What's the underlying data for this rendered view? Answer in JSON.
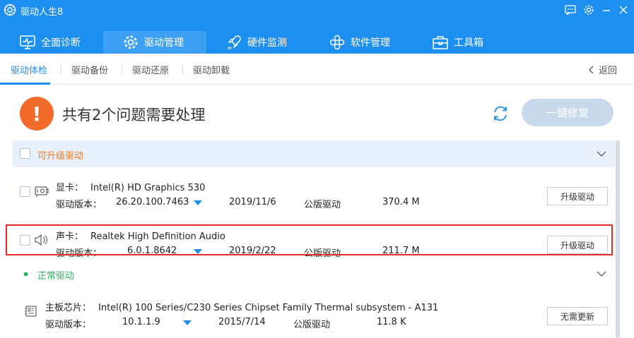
{
  "app": {
    "title": "驱动人生8"
  },
  "nav": {
    "tabs": [
      {
        "label": "全面诊断",
        "icon": "monitor-pulse-icon"
      },
      {
        "label": "驱动管理",
        "icon": "gear-icon",
        "active": true
      },
      {
        "label": "硬件监测",
        "icon": "rocket-icon"
      },
      {
        "label": "软件管理",
        "icon": "apps-icon"
      },
      {
        "label": "工具箱",
        "icon": "toolbox-icon"
      }
    ]
  },
  "subnav": {
    "items": [
      "驱动体检",
      "驱动备份",
      "驱动还原",
      "驱动卸载"
    ],
    "back_label": "返回"
  },
  "summary": {
    "title": "共有2个问题需要处理",
    "fix_all_label": "一键修复"
  },
  "sections": {
    "upgradable": {
      "label": "可升级驱动"
    },
    "normal": {
      "label": "正常驱动"
    }
  },
  "drivers": [
    {
      "type_label": "显卡：",
      "name": "Intel(R) HD Graphics 530",
      "version_label": "驱动版本：",
      "version": "26.20.100.7463",
      "date": "2019/11/6",
      "kind": "公版驱动",
      "size": "370.4 M",
      "action": "升级驱动",
      "icon": "graphics-card-icon"
    },
    {
      "type_label": "声卡：",
      "name": "Realtek High Definition Audio",
      "version_label": "驱动版本：",
      "version": "6.0.1.8642",
      "date": "2019/2/22",
      "kind": "公版驱动",
      "size": "211.7 M",
      "action": "升级驱动",
      "icon": "speaker-icon"
    },
    {
      "type_label": "主板芯片：",
      "name": "Intel(R) 100 Series/C230 Series Chipset Family Thermal subsystem - A131",
      "version_label": "驱动版本：",
      "version": "10.1.1.9",
      "date": "2015/7/14",
      "kind": "公版驱动",
      "size": "11.8 K",
      "action": "无需更新",
      "icon": "chip-icon"
    }
  ],
  "colors": {
    "brand_blue": "#1d8ff0",
    "warning_orange": "#f26b2b",
    "upgrade_label": "#f27a21",
    "normal_label": "#2bb359",
    "highlight_red": "#e02b2b"
  }
}
